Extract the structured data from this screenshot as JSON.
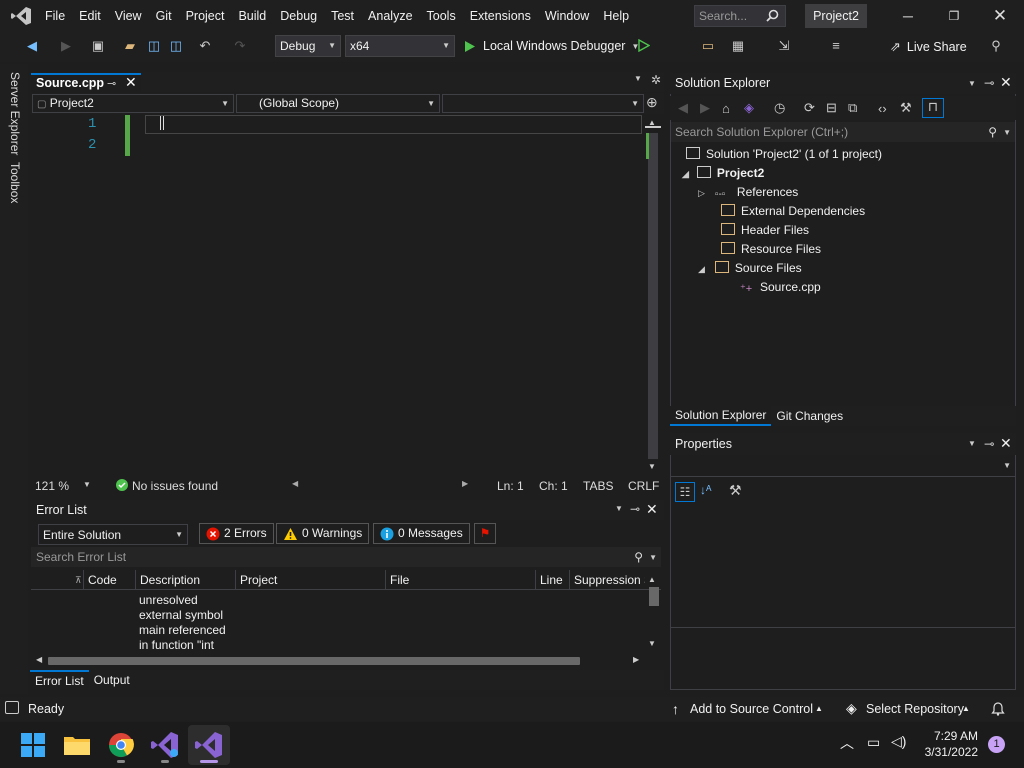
{
  "menu": [
    "File",
    "Edit",
    "View",
    "Git",
    "Project",
    "Build",
    "Debug",
    "Test",
    "Analyze",
    "Tools",
    "Extensions",
    "Window",
    "Help"
  ],
  "search": {
    "placeholder": "Search..."
  },
  "window": {
    "title": "Project2"
  },
  "toolbar": {
    "config": "Debug",
    "platform": "x64",
    "debugger": "Local Windows Debugger",
    "live_share": "Live Share"
  },
  "side_tabs": [
    "Server Explorer",
    "Toolbox"
  ],
  "editor": {
    "tab": "Source.cpp",
    "nav_project": "Project2",
    "nav_scope": "(Global Scope)",
    "lines": [
      "1",
      "2"
    ],
    "zoom": "121 %",
    "issues": "No issues found",
    "ln": "Ln: 1",
    "ch": "Ch: 1",
    "tabs": "TABS",
    "eol": "CRLF"
  },
  "error_list": {
    "title": "Error List",
    "scope": "Entire Solution",
    "errors": "2 Errors",
    "warnings": "0 Warnings",
    "messages": "0 Messages",
    "search": "Search Error List",
    "columns": [
      "Code",
      "Description",
      "Project",
      "File",
      "Line",
      "Suppression S"
    ],
    "row_desc": [
      "unresolved",
      "external symbol",
      "main referenced",
      "in function \"int"
    ],
    "tabs": [
      "Error List",
      "Output"
    ]
  },
  "solution_explorer": {
    "title": "Solution Explorer",
    "search": "Search Solution Explorer (Ctrl+;)",
    "solution": "Solution 'Project2' (1 of 1 project)",
    "project": "Project2",
    "items": [
      "References",
      "External Dependencies",
      "Header Files",
      "Resource Files",
      "Source Files"
    ],
    "file": "Source.cpp",
    "tabs": [
      "Solution Explorer",
      "Git Changes"
    ]
  },
  "properties": {
    "title": "Properties"
  },
  "status": {
    "ready": "Ready",
    "source_control": "Add to Source Control",
    "repo": "Select Repository"
  },
  "taskbar": {
    "time": "7:29 AM",
    "date": "3/31/2022",
    "notifications": "1"
  },
  "colors": {
    "accent": "#0078d4",
    "vs_purple": "#8a63d2",
    "error_red": "#e51400",
    "warning_yellow": "#ffcc00",
    "info_blue": "#1ba1e2"
  }
}
